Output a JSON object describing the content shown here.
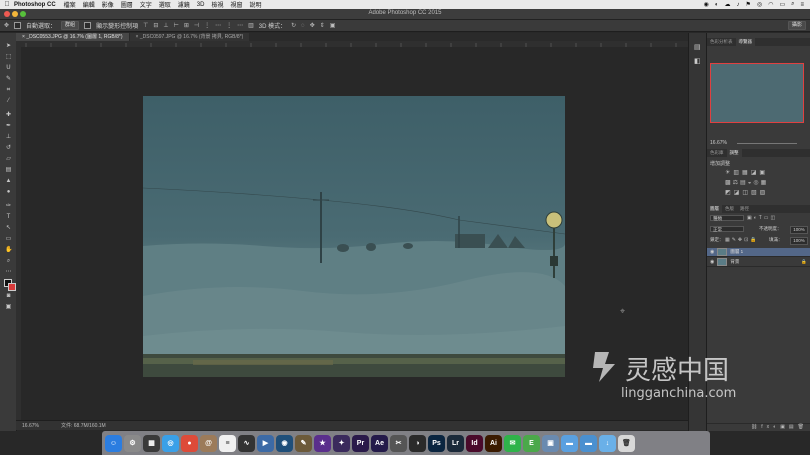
{
  "menubar": {
    "app_name": "Photoshop CC",
    "items": [
      "檔案",
      "編輯",
      "影像",
      "圖層",
      "文字",
      "選取",
      "濾鏡",
      "3D",
      "檢視",
      "視窗",
      "說明"
    ]
  },
  "window": {
    "title": "Adobe Photoshop CC 2015"
  },
  "options": {
    "auto_select_label": "自動選取：",
    "auto_select_value": "群組",
    "show_transform_label": "顯示變形控制項",
    "mode_3d_label": "3D 模式：",
    "workspace": "攝影"
  },
  "tabs": [
    {
      "label": "_DSC0553.JPG @ 16.7% (圖層 1, RGB/8*)",
      "close": "×"
    },
    {
      "label": "_DSC0597.JPG @ 16.7% (背景 拷貝, RGB/8*)",
      "close": "×"
    }
  ],
  "status": {
    "zoom": "16.67%",
    "doc": "文件: 68.7M/160.1M"
  },
  "navigator": {
    "tabs": [
      "色彩分析表",
      "導覽器"
    ],
    "zoom": "16.67%"
  },
  "adjustments": {
    "tabs": [
      "色彩庫",
      "調整"
    ],
    "heading": "增加調整"
  },
  "layers": {
    "tabs": [
      "圖層",
      "色版",
      "路徑"
    ],
    "filter_kind": "種類",
    "blend_mode": "正常",
    "opacity_label": "不透明度：",
    "opacity_value": "100%",
    "lock_label": "鎖定：",
    "fill_label": "填滿：",
    "fill_value": "100%",
    "items": [
      {
        "name": "圖層 1",
        "selected": true
      },
      {
        "name": "背景",
        "selected": false
      }
    ]
  },
  "dock": {
    "apps": [
      {
        "name": "Finder",
        "color": "#2b7de0",
        "glyph": "☺"
      },
      {
        "name": "System Preferences",
        "color": "#8a8a8a",
        "glyph": "⚙"
      },
      {
        "name": "Launchpad",
        "color": "#3a3a3a",
        "glyph": "▦"
      },
      {
        "name": "Safari",
        "color": "#3aa0e8",
        "glyph": "◎"
      },
      {
        "name": "Chrome",
        "color": "#dd4b39",
        "glyph": "●"
      },
      {
        "name": "Contacts",
        "color": "#9c7b5a",
        "glyph": "@"
      },
      {
        "name": "Notes",
        "color": "#f0f0f0",
        "glyph": "≡"
      },
      {
        "name": "Activity",
        "color": "#333",
        "glyph": "∿"
      },
      {
        "name": "QuickTime",
        "color": "#3c6aa6",
        "glyph": "▶"
      },
      {
        "name": "Utility",
        "color": "#1f4f7a",
        "glyph": "◉"
      },
      {
        "name": "Keynote",
        "color": "#6c5a3a",
        "glyph": "✎"
      },
      {
        "name": "iMovie",
        "color": "#5a2e8c",
        "glyph": "★"
      },
      {
        "name": "FCP",
        "color": "#3a2a5c",
        "glyph": "✦"
      },
      {
        "name": "Premiere",
        "color": "#2a1a4a",
        "glyph": "Pr"
      },
      {
        "name": "After Effects",
        "color": "#241a4a",
        "glyph": "Ae"
      },
      {
        "name": "Final Cut",
        "color": "#555",
        "glyph": "✂"
      },
      {
        "name": "DaVinci",
        "color": "#2a2a2a",
        "glyph": "◑"
      },
      {
        "name": "Photoshop",
        "color": "#0a2540",
        "glyph": "Ps"
      },
      {
        "name": "Lightroom",
        "color": "#1b2a3a",
        "glyph": "Lr"
      },
      {
        "name": "InDesign",
        "color": "#4a0a2a",
        "glyph": "Id"
      },
      {
        "name": "Illustrator",
        "color": "#3a1a00",
        "glyph": "Ai"
      },
      {
        "name": "WeChat",
        "color": "#2fb34a",
        "glyph": "✉"
      },
      {
        "name": "Evernote",
        "color": "#4ba84a",
        "glyph": "E"
      },
      {
        "name": "Preview",
        "color": "#6a8ab0",
        "glyph": "▣"
      },
      {
        "name": "Folder1",
        "color": "#5aa0e0",
        "glyph": "▬"
      },
      {
        "name": "Folder2",
        "color": "#4a90d0",
        "glyph": "▬"
      },
      {
        "name": "Downloads",
        "color": "#6ab0e8",
        "glyph": "↓"
      },
      {
        "name": "Trash",
        "color": "#d8d8d8",
        "glyph": "🗑"
      }
    ]
  },
  "watermark": {
    "name_cn": "灵感中国",
    "url": "lingganchina.com"
  },
  "colors": {
    "accent": "#536788",
    "photo_tint": "#3f5f66"
  }
}
